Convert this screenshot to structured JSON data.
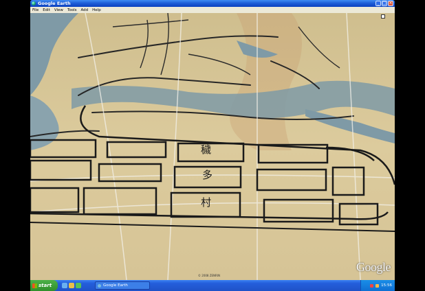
{
  "window": {
    "title": "Google Earth",
    "minimize": "_",
    "maximize": "□",
    "close": "×"
  },
  "menu": [
    "File",
    "Edit",
    "View",
    "Tools",
    "Add",
    "Help"
  ],
  "map": {
    "characters": [
      "穢",
      "多",
      "村"
    ],
    "logo": "Google",
    "copyright": "© 2008 ZENRIN"
  },
  "taskbar": {
    "start_label": "start",
    "task_label": "Google Earth",
    "clock": "15:56"
  },
  "colors": {
    "paper": "#d9c79a",
    "water": "#7f9aa6",
    "ink": "#1a1a1a",
    "title_blue": "#1f5fd8",
    "taskbar_blue": "#245edb",
    "start_green": "#3a9b34"
  }
}
